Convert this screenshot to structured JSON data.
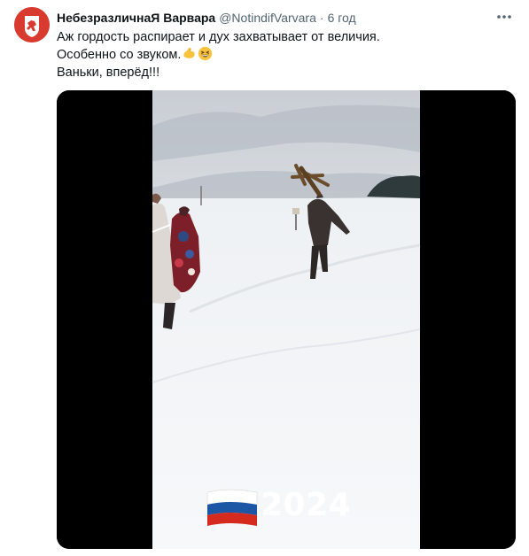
{
  "tweet": {
    "author": {
      "display_name": "НебезразличнаЯ Варвара",
      "handle": "@NotindifVarvara",
      "separator": "·",
      "time": "6 год"
    },
    "text_lines": [
      "Аж гордость распирает и дух захватывает от величия.",
      "Особенно со звуком.",
      "Ваньки, вперёд!!!"
    ],
    "emojis": [
      "flexed-biceps-icon",
      "grinning-squinting-face-icon"
    ],
    "media": {
      "caption": "2024",
      "flag": "russian-flag"
    }
  },
  "colors": {
    "text": "#0f1419",
    "secondary": "#536471",
    "avatar": "#d93a2f",
    "flag_white": "#ffffff",
    "flag_blue": "#1c57a5",
    "flag_red": "#d52b1e"
  }
}
